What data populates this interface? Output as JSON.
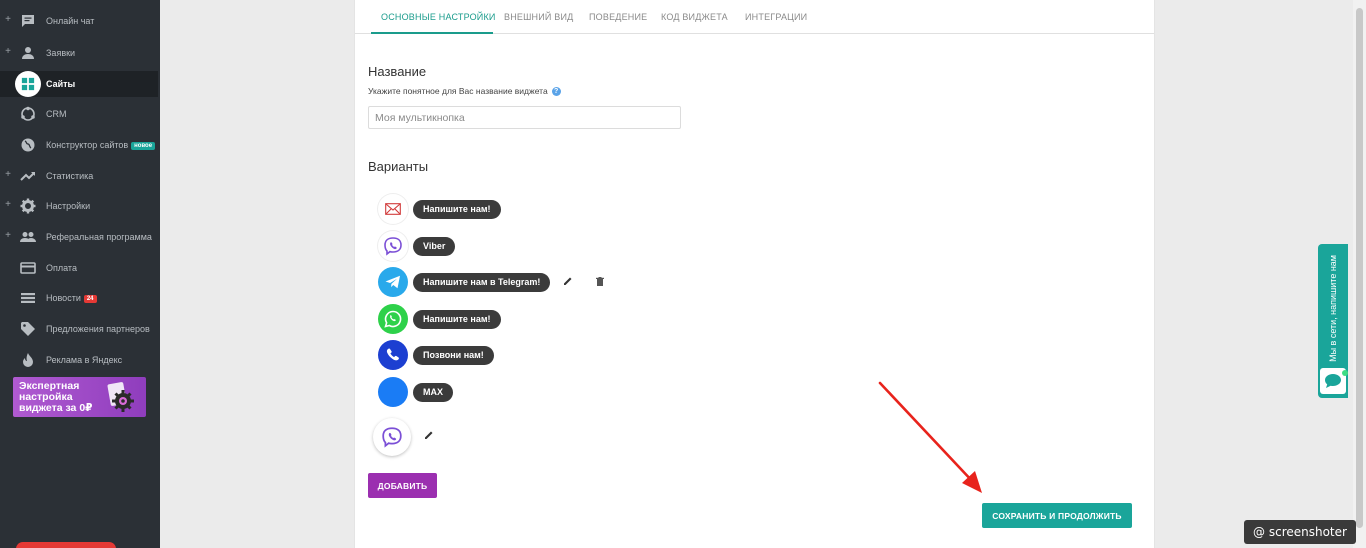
{
  "sidebar": {
    "items": [
      {
        "label": "Онлайн чат",
        "icon": "chat-icon",
        "expandable": true,
        "badge": ""
      },
      {
        "label": "Заявки",
        "icon": "person-icon",
        "expandable": true,
        "badge": ""
      },
      {
        "label": "Сайты",
        "icon": "sites-icon",
        "expandable": false,
        "active": true,
        "badge": ""
      },
      {
        "label": "CRM",
        "icon": "crm-icon",
        "expandable": false,
        "badge": ""
      },
      {
        "label": "Конструктор сайтов",
        "icon": "globe-icon",
        "expandable": false,
        "badge": "новое"
      },
      {
        "label": "Статистика",
        "icon": "trend-icon",
        "expandable": true,
        "badge": ""
      },
      {
        "label": "Настройки",
        "icon": "gear-icon",
        "expandable": true,
        "badge": ""
      },
      {
        "label": "Реферальная программа",
        "icon": "people-icon",
        "expandable": true,
        "badge": ""
      },
      {
        "label": "Оплата",
        "icon": "card-icon",
        "expandable": false,
        "badge": ""
      },
      {
        "label": "Новости",
        "icon": "list-icon",
        "expandable": false,
        "badge": "24"
      },
      {
        "label": "Предложения партнеров",
        "icon": "tag-icon",
        "expandable": false,
        "badge": ""
      },
      {
        "label": "Реклама в Яндекс",
        "icon": "fire-icon",
        "expandable": false,
        "badge": ""
      }
    ],
    "plus_symbol": "+",
    "promo_text": "Экспертная настройка виджета за 0₽"
  },
  "tabs": [
    {
      "label": "ОСНОВНЫЕ НАСТРОЙКИ",
      "active": true
    },
    {
      "label": "ВНЕШНИЙ ВИД",
      "active": false
    },
    {
      "label": "ПОВЕДЕНИЕ",
      "active": false
    },
    {
      "label": "КОД ВИДЖЕТА",
      "active": false
    },
    {
      "label": "ИНТЕГРАЦИИ",
      "active": false
    }
  ],
  "form": {
    "name_title": "Название",
    "name_hint": "Укажите понятное для Вас название виджета",
    "hint_icon": "?",
    "name_placeholder": "Моя мультикнопка",
    "name_value": "",
    "variants_title": "Варианты"
  },
  "variants": [
    {
      "label": "Напишите нам!",
      "icon": "email-icon",
      "color": "#ffffff"
    },
    {
      "label": "Viber",
      "icon": "viber-icon",
      "color": "#ffffff"
    },
    {
      "label": "Напишите нам в Telegram!",
      "icon": "telegram-icon",
      "color": "#29a9eb"
    },
    {
      "label": "Напишите нам!",
      "icon": "whatsapp-icon",
      "color": "#2ed14a"
    },
    {
      "label": "Позвони нам!",
      "icon": "phone-icon",
      "color": "#1c3fd1"
    },
    {
      "label": "MAX",
      "icon": "max-icon",
      "color": "#1a7cf5"
    }
  ],
  "buttons": {
    "add": "ДОБАВИТЬ",
    "save": "СОХРАНИТЬ И ПРОДОЛЖИТЬ"
  },
  "side_widget": {
    "text": "Мы в сети, напишите нам"
  },
  "watermark": "@ screenshoter",
  "colors": {
    "accent": "#1aa59a",
    "add_button": "#9b2fb0",
    "sidebar_bg": "#2b3036",
    "arrow": "#e8231c"
  }
}
